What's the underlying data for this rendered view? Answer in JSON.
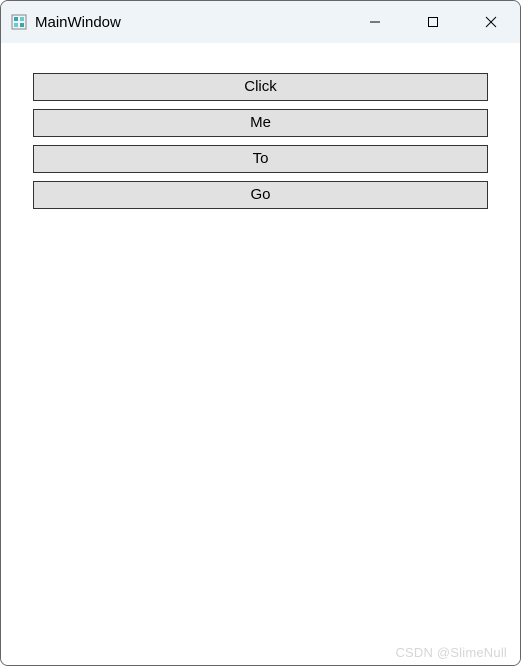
{
  "window": {
    "title": "MainWindow"
  },
  "buttons": [
    {
      "label": "Click"
    },
    {
      "label": "Me"
    },
    {
      "label": "To"
    },
    {
      "label": "Go"
    }
  ],
  "watermark": "CSDN @SlimeNull"
}
